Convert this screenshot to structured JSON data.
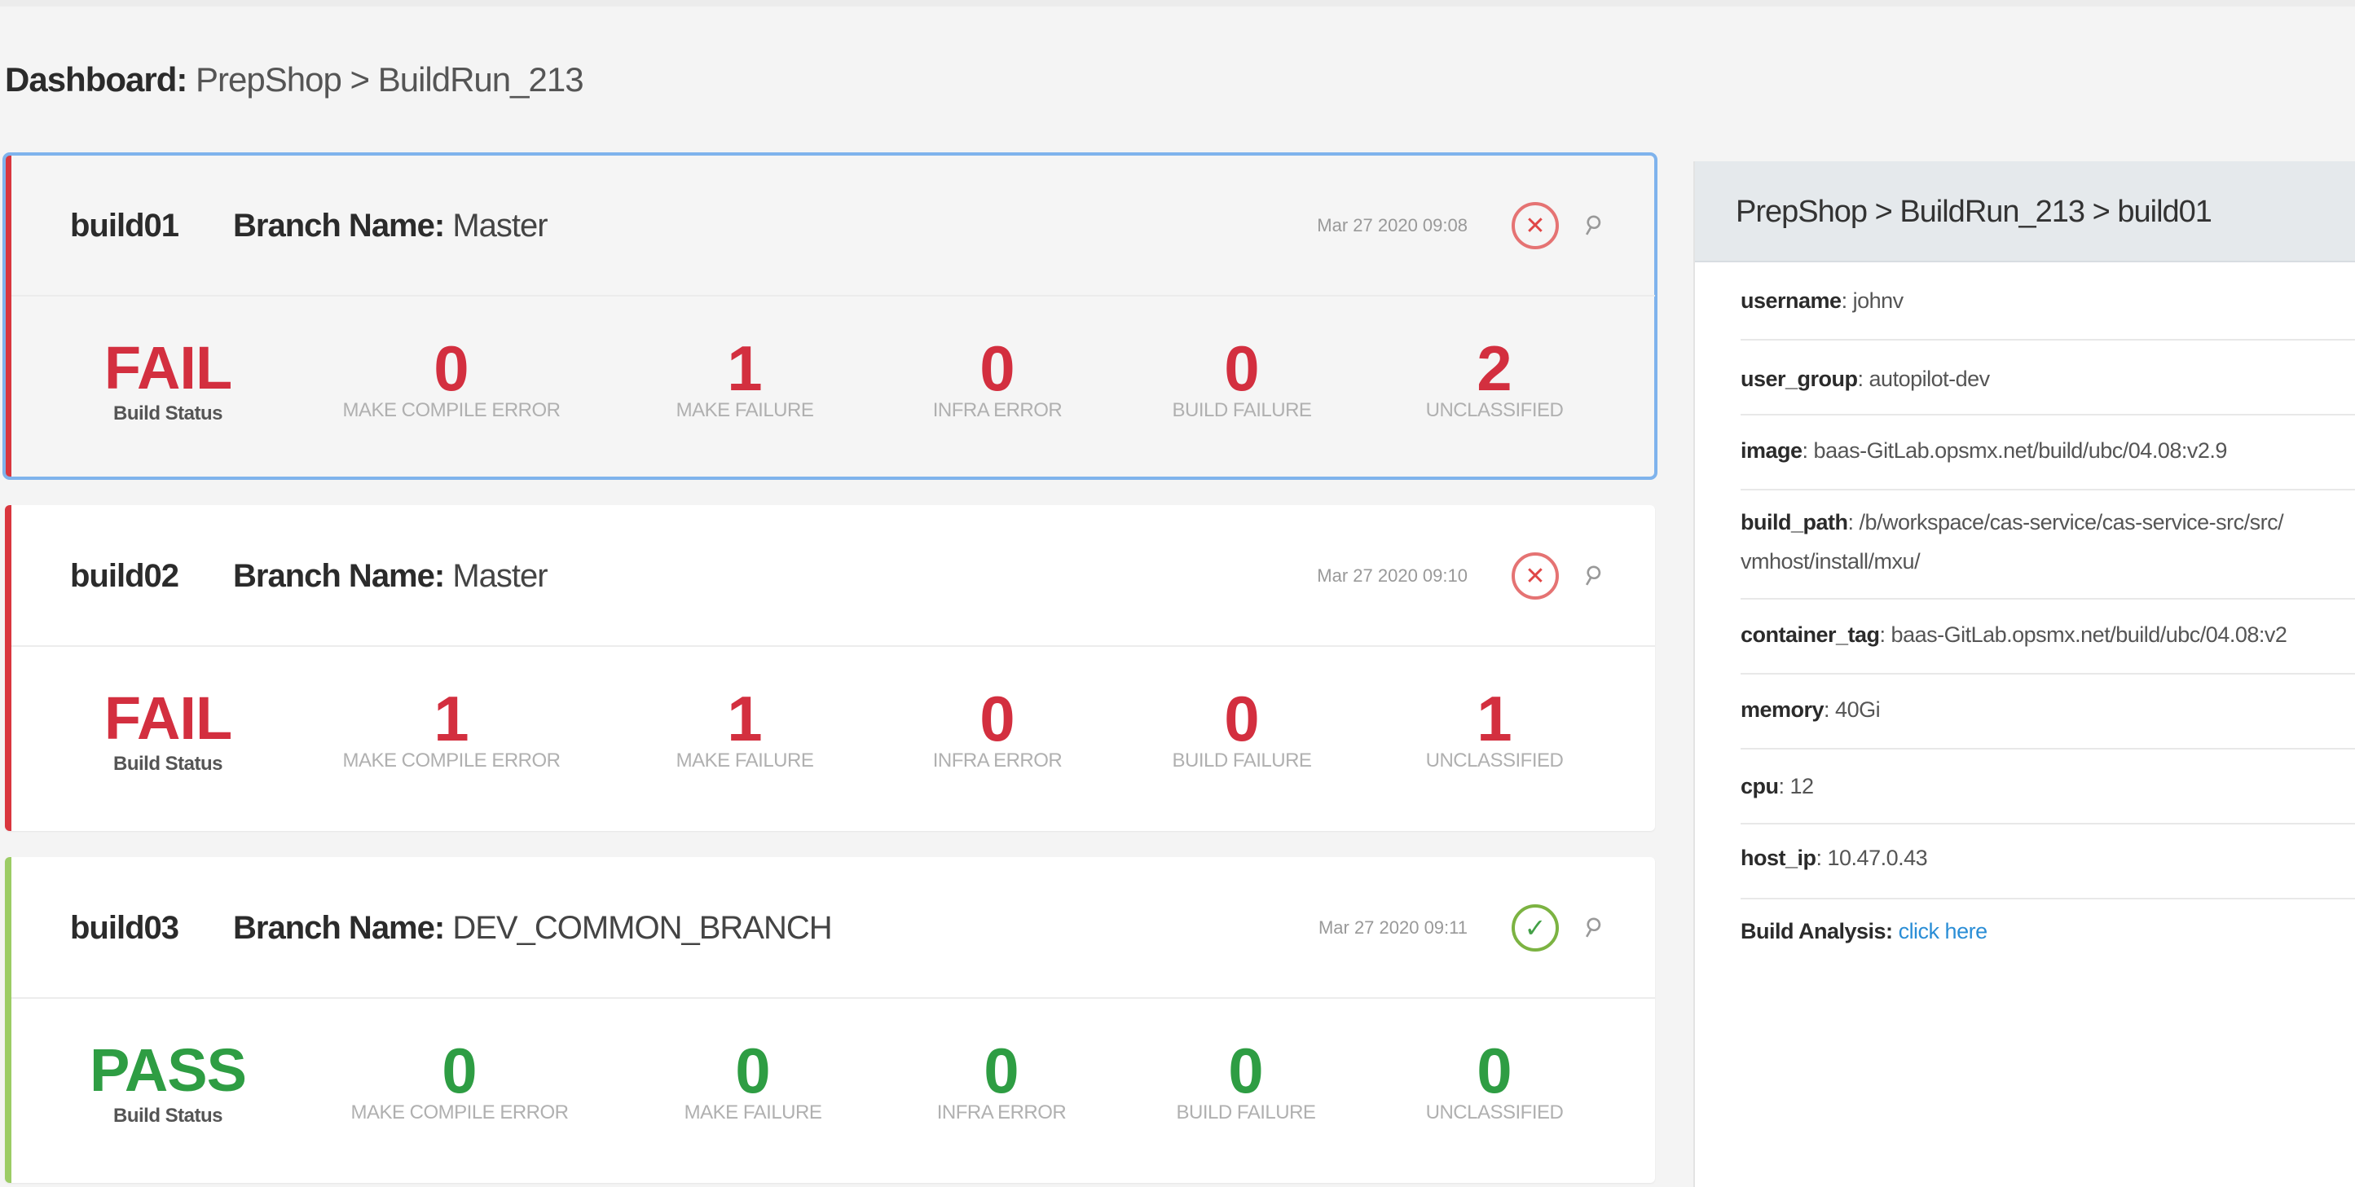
{
  "breadcrumb": {
    "label": "Dashboard:",
    "path": "PrepShop > BuildRun_213"
  },
  "builds": [
    {
      "id": "build01",
      "branch_label": "Branch Name:",
      "branch": "Master",
      "timestamp": "Mar 27 2020 09:08",
      "status_icon": "x-circle-icon",
      "status": "FAIL",
      "status_label": "Build Status",
      "metrics": [
        {
          "value": "0",
          "label": "MAKE COMPILE ERROR"
        },
        {
          "value": "1",
          "label": "MAKE FAILURE"
        },
        {
          "value": "0",
          "label": "INFRA ERROR"
        },
        {
          "value": "0",
          "label": "BUILD FAILURE"
        },
        {
          "value": "2",
          "label": "UNCLASSIFIED"
        }
      ]
    },
    {
      "id": "build02",
      "branch_label": "Branch Name:",
      "branch": "Master",
      "timestamp": "Mar 27 2020 09:10",
      "status_icon": "x-circle-icon",
      "status": "FAIL",
      "status_label": "Build Status",
      "metrics": [
        {
          "value": "1",
          "label": "MAKE COMPILE ERROR"
        },
        {
          "value": "1",
          "label": "MAKE FAILURE"
        },
        {
          "value": "0",
          "label": "INFRA ERROR"
        },
        {
          "value": "0",
          "label": "BUILD FAILURE"
        },
        {
          "value": "1",
          "label": "UNCLASSIFIED"
        }
      ]
    },
    {
      "id": "build03",
      "branch_label": "Branch Name:",
      "branch": "DEV_COMMON_BRANCH",
      "timestamp": "Mar 27 2020 09:11",
      "status_icon": "check-circle-icon",
      "status": "PASS",
      "status_label": "Build Status",
      "metrics": [
        {
          "value": "0",
          "label": "MAKE COMPILE ERROR"
        },
        {
          "value": "0",
          "label": "MAKE FAILURE"
        },
        {
          "value": "0",
          "label": "INFRA ERROR"
        },
        {
          "value": "0",
          "label": "BUILD FAILURE"
        },
        {
          "value": "0",
          "label": "UNCLASSIFIED"
        }
      ]
    }
  ],
  "detail": {
    "title": "PrepShop > BuildRun_213 > build01",
    "rows": [
      {
        "key": "username",
        "value": ": johnv"
      },
      {
        "key": "user_group",
        "value": ": autopilot-dev"
      },
      {
        "key": "image",
        "value": ": baas-GitLab.opsmx.net/build/ubc/04.08:v2.9"
      },
      {
        "key": "build_path",
        "value": ": /b/workspace/cas-service/cas-service-src/src/",
        "value2": "vmhost/install/mxu/"
      },
      {
        "key": "container_tag",
        "value": ": baas-GitLab.opsmx.net/build/ubc/04.08:v2"
      },
      {
        "key": "memory",
        "value": ": 40Gi"
      },
      {
        "key": "cpu",
        "value": ": 12"
      },
      {
        "key": "host_ip",
        "value": ": 10.47.0.43"
      },
      {
        "key": "Build Analysis:",
        "value": "click here"
      }
    ]
  },
  "colors": {
    "fail": "#d32f3f",
    "pass": "#2e9d43",
    "selected_outline": "#7fb3ec",
    "link": "#2b8ed6"
  }
}
